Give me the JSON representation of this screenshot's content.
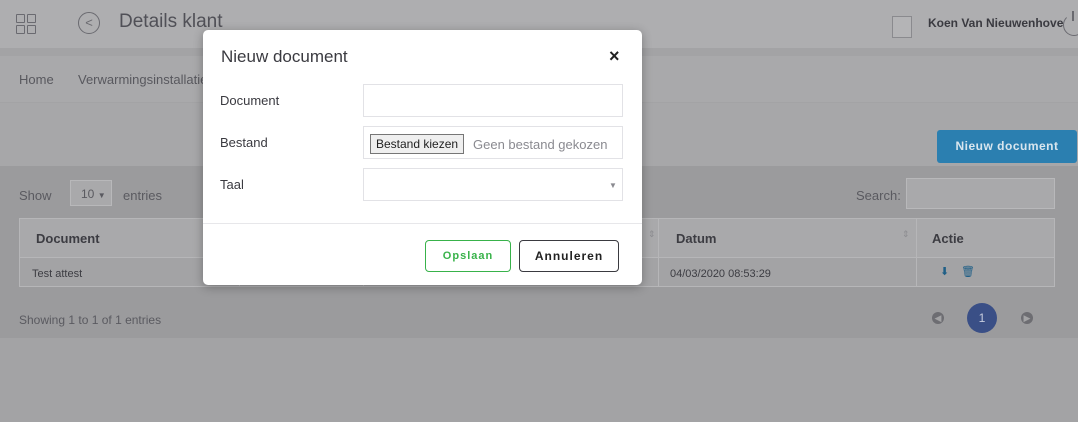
{
  "header": {
    "title": "Details klant",
    "user": "Koen Van Nieuwenhove"
  },
  "breadcrumb": {
    "home": "Home",
    "current": "Verwarmingsinstallaties"
  },
  "toolbar": {
    "new_document": "Nieuw document"
  },
  "table": {
    "show": "Show",
    "length": "10",
    "entries": "entries",
    "search_label": "Search:",
    "columns": [
      "Document",
      "Datum",
      "Actie"
    ],
    "rows": [
      {
        "document": "Test attest",
        "datum": "04/03/2020 08:53:29"
      }
    ],
    "info": "Showing 1 to 1 of 1 entries",
    "page": "1"
  },
  "modal": {
    "title": "Nieuw document",
    "close": "×",
    "fields": {
      "document": "Document",
      "bestand": "Bestand",
      "taal": "Taal"
    },
    "file_button": "Bestand kiezen",
    "file_status": "Geen bestand gekozen",
    "save": "Opslaan",
    "cancel": "Annuleren"
  }
}
